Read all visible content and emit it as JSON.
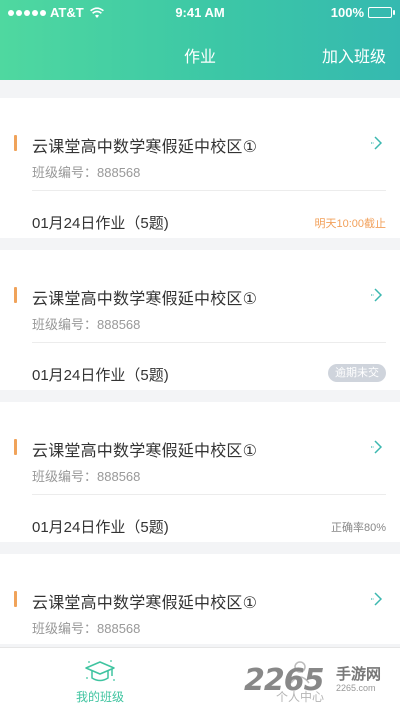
{
  "status_bar": {
    "carrier": "AT&T",
    "time": "9:41 AM",
    "battery": "100%"
  },
  "nav": {
    "title": "作业",
    "action_label": "加入班级"
  },
  "cards": [
    {
      "class_name": "云课堂高中数学寒假延中校区①",
      "class_code": "班级编号：888568",
      "homework": "01月24日作业（5题)",
      "status_type": "deadline",
      "status_text": "明天10:00截止"
    },
    {
      "class_name": "云课堂高中数学寒假延中校区①",
      "class_code": "班级编号：888568",
      "homework": "01月24日作业（5题)",
      "status_type": "overdue",
      "status_text": "逾期未交"
    },
    {
      "class_name": "云课堂高中数学寒假延中校区①",
      "class_code": "班级编号：888568",
      "homework": "01月24日作业（5题)",
      "status_type": "accuracy",
      "status_text": "正确率80%"
    },
    {
      "class_name": "云课堂高中数学寒假延中校区①",
      "class_code": "班级编号：888568"
    }
  ],
  "tabbar": {
    "tabs": [
      {
        "label": "我的班级",
        "icon": "graduation-cap-icon",
        "active": true
      },
      {
        "label": "个人中心",
        "icon": "person-icon",
        "active": false
      }
    ]
  },
  "watermark": {
    "number": "2265",
    "text": "手游网",
    "url": "2265.com"
  },
  "colors": {
    "header_gradient_start": "#4fd8a0",
    "header_gradient_end": "#35b9b0",
    "accent": "#3fc4a0",
    "title_marker": "#f0a35a",
    "deadline": "#f2a05a",
    "overdue_badge": "#cfd4dc"
  }
}
